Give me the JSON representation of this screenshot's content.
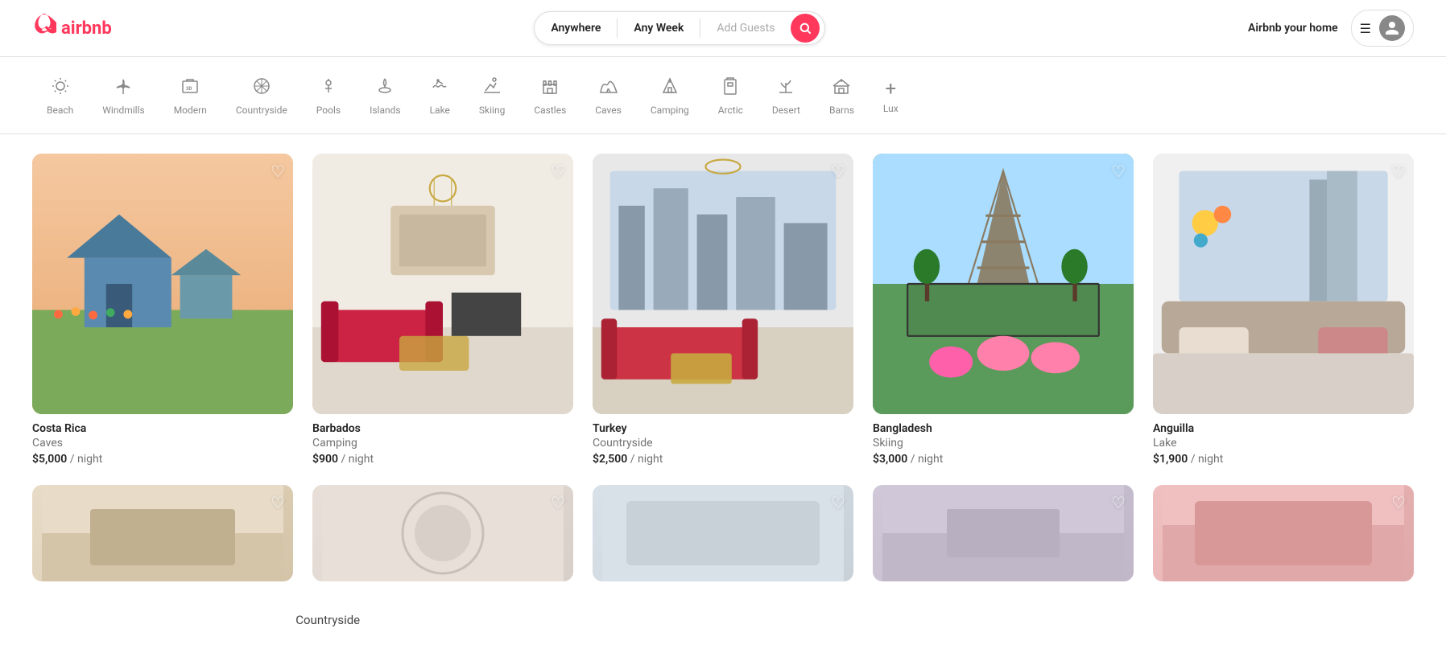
{
  "header": {
    "logo_text": "airbnb",
    "host_link": "Airbnb your home",
    "search": {
      "location": "Anywhere",
      "dates": "Any Week",
      "guests_placeholder": "Add Guests"
    }
  },
  "categories": [
    {
      "id": "beach",
      "label": "Beach",
      "icon": "☀️"
    },
    {
      "id": "windmills",
      "label": "Windmills",
      "icon": "⚙️"
    },
    {
      "id": "modern",
      "label": "Modern",
      "icon": "3D"
    },
    {
      "id": "countryside",
      "label": "Countryside",
      "icon": "◑"
    },
    {
      "id": "pools",
      "label": "Pools",
      "icon": "⚓"
    },
    {
      "id": "islands",
      "label": "Islands",
      "icon": "🌴"
    },
    {
      "id": "lake",
      "label": "Lake",
      "icon": "🚣"
    },
    {
      "id": "skiing",
      "label": "Skiing",
      "icon": "⛷"
    },
    {
      "id": "castles",
      "label": "Castles",
      "icon": "🏰"
    },
    {
      "id": "caves",
      "label": "Caves",
      "icon": "🗿"
    },
    {
      "id": "camping",
      "label": "Camping",
      "icon": "🌲"
    },
    {
      "id": "arctic",
      "label": "Arctic",
      "icon": "🛍"
    },
    {
      "id": "desert",
      "label": "Desert",
      "icon": "🌵"
    },
    {
      "id": "barns",
      "label": "Barns",
      "icon": "🏚"
    },
    {
      "id": "lux",
      "label": "Lux",
      "icon": "+"
    }
  ],
  "listings": [
    {
      "id": 1,
      "country": "Costa Rica",
      "type": "Caves",
      "price": "$5,000",
      "unit": "/ night",
      "img_class": "img-costa-rica"
    },
    {
      "id": 2,
      "country": "Barbados",
      "type": "Camping",
      "price": "$900",
      "unit": "/ night",
      "img_class": "img-barbados"
    },
    {
      "id": 3,
      "country": "Turkey",
      "type": "Countryside",
      "price": "$2,500",
      "unit": "/ night",
      "img_class": "img-turkey"
    },
    {
      "id": 4,
      "country": "Bangladesh",
      "type": "Skiing",
      "price": "$3,000",
      "unit": "/ night",
      "img_class": "img-bangladesh"
    },
    {
      "id": 5,
      "country": "Anguilla",
      "type": "Lake",
      "price": "$1,900",
      "unit": "/ night",
      "img_class": "img-anguilla"
    }
  ],
  "bottom_listings": [
    {
      "id": 6,
      "img_class": "img-bottom1"
    },
    {
      "id": 7,
      "img_class": "img-bottom2"
    },
    {
      "id": 8,
      "img_class": "img-bottom3"
    },
    {
      "id": 9,
      "img_class": "img-bottom4"
    },
    {
      "id": 10,
      "img_class": "img-bottom5"
    }
  ],
  "bottom_label": "Countryside",
  "heart_icon": "♡"
}
